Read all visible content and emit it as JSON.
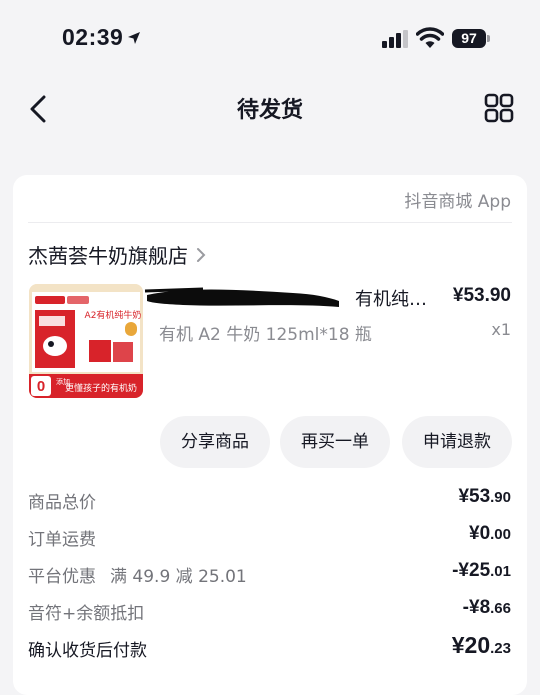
{
  "status": {
    "time": "02:39",
    "battery": "97"
  },
  "nav": {
    "title": "待发货"
  },
  "card": {
    "source": "抖音商城 App",
    "shop_name": "杰茜荟牛奶旗舰店"
  },
  "product": {
    "title_visible": "有机纯…",
    "price": "¥53.90",
    "spec": "有机 A2 牛奶 125ml*18 瓶",
    "qty": "x1",
    "thumb_text": {
      "brand": "A2有机纯牛奶",
      "badge": "0",
      "badge_sub": "添加",
      "slogan": "更懂孩子的有机奶"
    }
  },
  "actions": {
    "share": "分享商品",
    "rebuy": "再买一单",
    "refund": "申请退款"
  },
  "summary": [
    {
      "label": "商品总价",
      "sub": "",
      "value_main": "¥53",
      "value_dec": ".90"
    },
    {
      "label": "订单运费",
      "sub": "",
      "value_main": "¥0",
      "value_dec": ".00"
    },
    {
      "label": "平台优惠",
      "sub": "满 49.9 减 25.01",
      "value_main": "-¥25",
      "value_dec": ".01"
    },
    {
      "label": "音符+余额抵扣",
      "sub": "",
      "value_main": "-¥8",
      "value_dec": ".66"
    },
    {
      "label": "确认收货后付款",
      "sub": "",
      "value_main": "¥20",
      "value_dec": ".23"
    }
  ]
}
